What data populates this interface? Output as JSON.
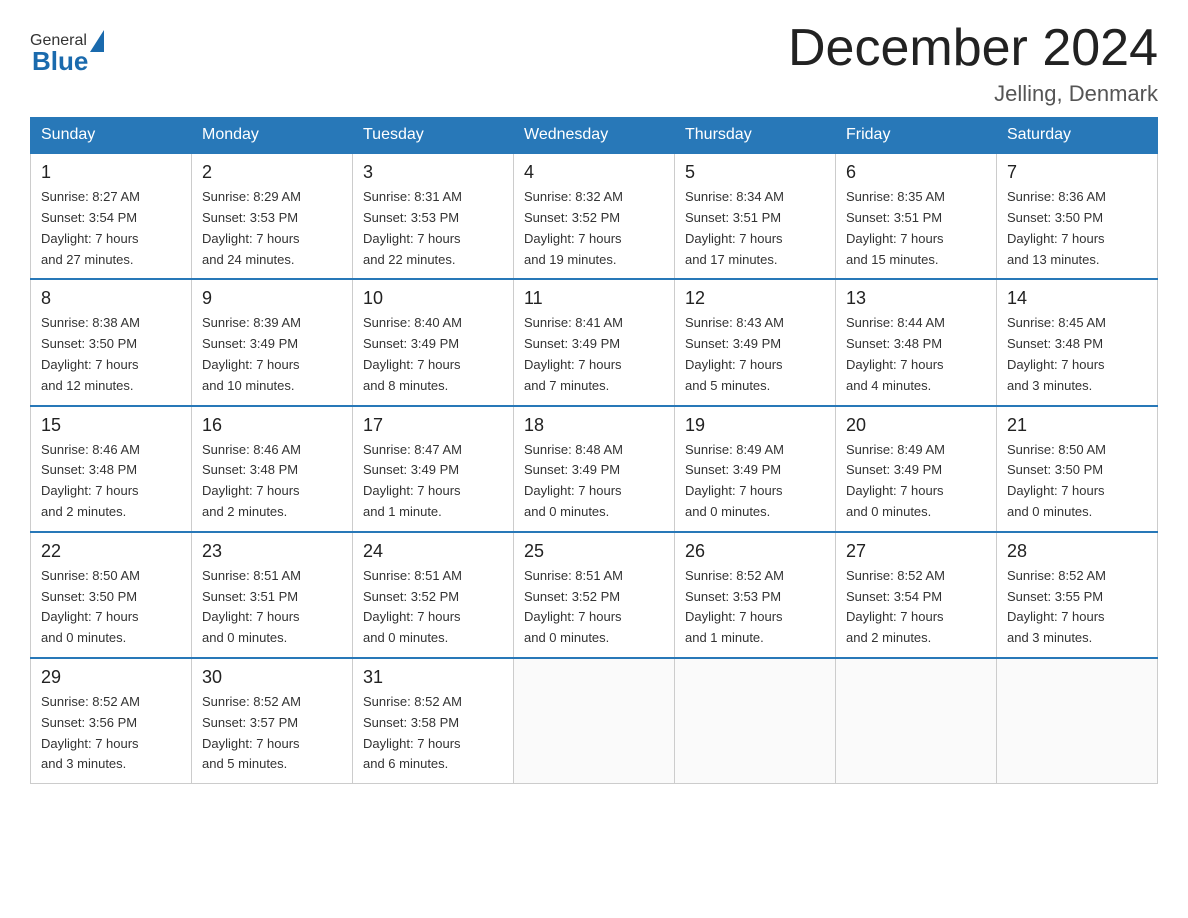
{
  "header": {
    "logo_general": "General",
    "logo_blue": "Blue",
    "title": "December 2024",
    "location": "Jelling, Denmark"
  },
  "days_of_week": [
    "Sunday",
    "Monday",
    "Tuesday",
    "Wednesday",
    "Thursday",
    "Friday",
    "Saturday"
  ],
  "weeks": [
    [
      {
        "day": "1",
        "sunrise": "Sunrise: 8:27 AM",
        "sunset": "Sunset: 3:54 PM",
        "daylight": "Daylight: 7 hours",
        "daylight2": "and 27 minutes."
      },
      {
        "day": "2",
        "sunrise": "Sunrise: 8:29 AM",
        "sunset": "Sunset: 3:53 PM",
        "daylight": "Daylight: 7 hours",
        "daylight2": "and 24 minutes."
      },
      {
        "day": "3",
        "sunrise": "Sunrise: 8:31 AM",
        "sunset": "Sunset: 3:53 PM",
        "daylight": "Daylight: 7 hours",
        "daylight2": "and 22 minutes."
      },
      {
        "day": "4",
        "sunrise": "Sunrise: 8:32 AM",
        "sunset": "Sunset: 3:52 PM",
        "daylight": "Daylight: 7 hours",
        "daylight2": "and 19 minutes."
      },
      {
        "day": "5",
        "sunrise": "Sunrise: 8:34 AM",
        "sunset": "Sunset: 3:51 PM",
        "daylight": "Daylight: 7 hours",
        "daylight2": "and 17 minutes."
      },
      {
        "day": "6",
        "sunrise": "Sunrise: 8:35 AM",
        "sunset": "Sunset: 3:51 PM",
        "daylight": "Daylight: 7 hours",
        "daylight2": "and 15 minutes."
      },
      {
        "day": "7",
        "sunrise": "Sunrise: 8:36 AM",
        "sunset": "Sunset: 3:50 PM",
        "daylight": "Daylight: 7 hours",
        "daylight2": "and 13 minutes."
      }
    ],
    [
      {
        "day": "8",
        "sunrise": "Sunrise: 8:38 AM",
        "sunset": "Sunset: 3:50 PM",
        "daylight": "Daylight: 7 hours",
        "daylight2": "and 12 minutes."
      },
      {
        "day": "9",
        "sunrise": "Sunrise: 8:39 AM",
        "sunset": "Sunset: 3:49 PM",
        "daylight": "Daylight: 7 hours",
        "daylight2": "and 10 minutes."
      },
      {
        "day": "10",
        "sunrise": "Sunrise: 8:40 AM",
        "sunset": "Sunset: 3:49 PM",
        "daylight": "Daylight: 7 hours",
        "daylight2": "and 8 minutes."
      },
      {
        "day": "11",
        "sunrise": "Sunrise: 8:41 AM",
        "sunset": "Sunset: 3:49 PM",
        "daylight": "Daylight: 7 hours",
        "daylight2": "and 7 minutes."
      },
      {
        "day": "12",
        "sunrise": "Sunrise: 8:43 AM",
        "sunset": "Sunset: 3:49 PM",
        "daylight": "Daylight: 7 hours",
        "daylight2": "and 5 minutes."
      },
      {
        "day": "13",
        "sunrise": "Sunrise: 8:44 AM",
        "sunset": "Sunset: 3:48 PM",
        "daylight": "Daylight: 7 hours",
        "daylight2": "and 4 minutes."
      },
      {
        "day": "14",
        "sunrise": "Sunrise: 8:45 AM",
        "sunset": "Sunset: 3:48 PM",
        "daylight": "Daylight: 7 hours",
        "daylight2": "and 3 minutes."
      }
    ],
    [
      {
        "day": "15",
        "sunrise": "Sunrise: 8:46 AM",
        "sunset": "Sunset: 3:48 PM",
        "daylight": "Daylight: 7 hours",
        "daylight2": "and 2 minutes."
      },
      {
        "day": "16",
        "sunrise": "Sunrise: 8:46 AM",
        "sunset": "Sunset: 3:48 PM",
        "daylight": "Daylight: 7 hours",
        "daylight2": "and 2 minutes."
      },
      {
        "day": "17",
        "sunrise": "Sunrise: 8:47 AM",
        "sunset": "Sunset: 3:49 PM",
        "daylight": "Daylight: 7 hours",
        "daylight2": "and 1 minute."
      },
      {
        "day": "18",
        "sunrise": "Sunrise: 8:48 AM",
        "sunset": "Sunset: 3:49 PM",
        "daylight": "Daylight: 7 hours",
        "daylight2": "and 0 minutes."
      },
      {
        "day": "19",
        "sunrise": "Sunrise: 8:49 AM",
        "sunset": "Sunset: 3:49 PM",
        "daylight": "Daylight: 7 hours",
        "daylight2": "and 0 minutes."
      },
      {
        "day": "20",
        "sunrise": "Sunrise: 8:49 AM",
        "sunset": "Sunset: 3:49 PM",
        "daylight": "Daylight: 7 hours",
        "daylight2": "and 0 minutes."
      },
      {
        "day": "21",
        "sunrise": "Sunrise: 8:50 AM",
        "sunset": "Sunset: 3:50 PM",
        "daylight": "Daylight: 7 hours",
        "daylight2": "and 0 minutes."
      }
    ],
    [
      {
        "day": "22",
        "sunrise": "Sunrise: 8:50 AM",
        "sunset": "Sunset: 3:50 PM",
        "daylight": "Daylight: 7 hours",
        "daylight2": "and 0 minutes."
      },
      {
        "day": "23",
        "sunrise": "Sunrise: 8:51 AM",
        "sunset": "Sunset: 3:51 PM",
        "daylight": "Daylight: 7 hours",
        "daylight2": "and 0 minutes."
      },
      {
        "day": "24",
        "sunrise": "Sunrise: 8:51 AM",
        "sunset": "Sunset: 3:52 PM",
        "daylight": "Daylight: 7 hours",
        "daylight2": "and 0 minutes."
      },
      {
        "day": "25",
        "sunrise": "Sunrise: 8:51 AM",
        "sunset": "Sunset: 3:52 PM",
        "daylight": "Daylight: 7 hours",
        "daylight2": "and 0 minutes."
      },
      {
        "day": "26",
        "sunrise": "Sunrise: 8:52 AM",
        "sunset": "Sunset: 3:53 PM",
        "daylight": "Daylight: 7 hours",
        "daylight2": "and 1 minute."
      },
      {
        "day": "27",
        "sunrise": "Sunrise: 8:52 AM",
        "sunset": "Sunset: 3:54 PM",
        "daylight": "Daylight: 7 hours",
        "daylight2": "and 2 minutes."
      },
      {
        "day": "28",
        "sunrise": "Sunrise: 8:52 AM",
        "sunset": "Sunset: 3:55 PM",
        "daylight": "Daylight: 7 hours",
        "daylight2": "and 3 minutes."
      }
    ],
    [
      {
        "day": "29",
        "sunrise": "Sunrise: 8:52 AM",
        "sunset": "Sunset: 3:56 PM",
        "daylight": "Daylight: 7 hours",
        "daylight2": "and 3 minutes."
      },
      {
        "day": "30",
        "sunrise": "Sunrise: 8:52 AM",
        "sunset": "Sunset: 3:57 PM",
        "daylight": "Daylight: 7 hours",
        "daylight2": "and 5 minutes."
      },
      {
        "day": "31",
        "sunrise": "Sunrise: 8:52 AM",
        "sunset": "Sunset: 3:58 PM",
        "daylight": "Daylight: 7 hours",
        "daylight2": "and 6 minutes."
      },
      null,
      null,
      null,
      null
    ]
  ]
}
